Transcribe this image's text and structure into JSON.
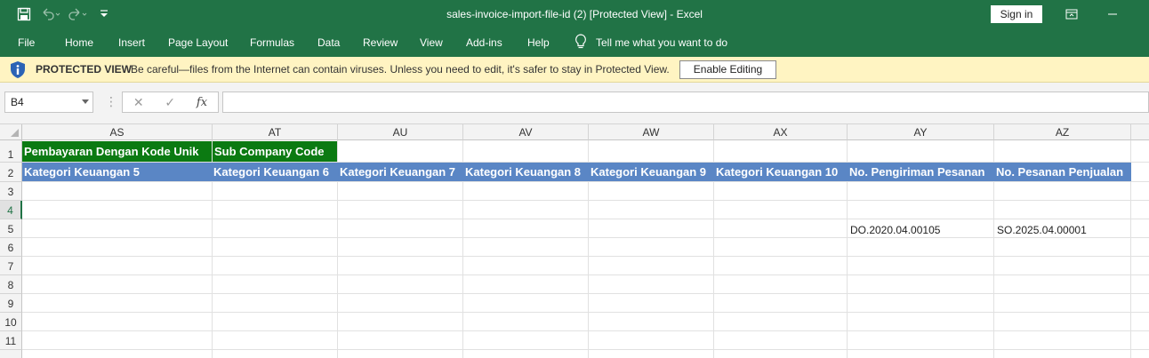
{
  "window": {
    "title": "sales-invoice-import-file-id (2)  [Protected View]  -  Excel",
    "sign_in_label": "Sign in"
  },
  "ribbon": {
    "tabs": [
      "File",
      "Home",
      "Insert",
      "Page Layout",
      "Formulas",
      "Data",
      "Review",
      "View",
      "Add-ins",
      "Help"
    ],
    "tell_me": "Tell me what you want to do"
  },
  "protected_view": {
    "title": "PROTECTED VIEW",
    "message": "Be careful—files from the Internet can contain viruses. Unless you need to edit, it's safer to stay in Protected View.",
    "button_label": "Enable Editing"
  },
  "formula_bar": {
    "name_box": "B4",
    "formula": ""
  },
  "colors": {
    "excel_green": "#217346",
    "header_green": "#0b7a12",
    "header_blue": "#5a86c5",
    "warning_bar": "#fff4c2"
  },
  "sheet": {
    "columns": [
      "AS",
      "AT",
      "AU",
      "AV",
      "AW",
      "AX",
      "AY",
      "AZ"
    ],
    "rows": [
      "1",
      "2",
      "3",
      "4",
      "5",
      "6",
      "7",
      "8",
      "9",
      "10",
      "11"
    ],
    "selected_row": "4",
    "row1": [
      "Pembayaran Dengan Kode Unik",
      "Sub Company Code"
    ],
    "row2": [
      "Kategori Keuangan 5",
      "Kategori Keuangan 6",
      "Kategori Keuangan 7",
      "Kategori Keuangan 8",
      "Kategori Keuangan 9",
      "Kategori Keuangan 10",
      "No. Pengiriman Pesanan",
      "No. Pesanan Penjualan"
    ],
    "row5": {
      "AY": "DO.2020.04.00105",
      "AZ": "SO.2025.04.00001"
    }
  }
}
